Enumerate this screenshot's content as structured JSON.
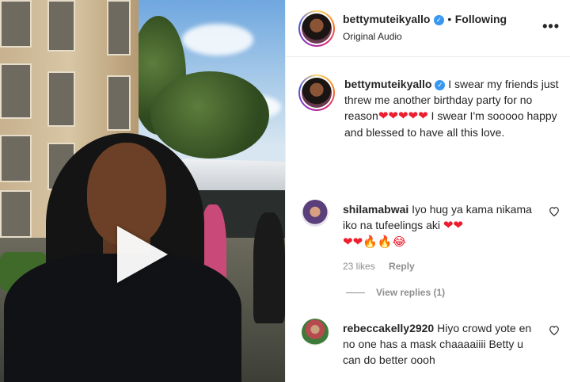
{
  "post": {
    "username": "bettymuteikyallo",
    "verified": true,
    "separator": "•",
    "follow_status": "Following",
    "audio": "Original Audio",
    "more_label": "•••"
  },
  "caption": {
    "username": "bettymuteikyallo",
    "text_1": "I swear my friends just threw me another birthday party for no reason",
    "hearts_1": "❤❤❤❤❤",
    "text_2": "I swear I'm sooooo happy and blessed to have all this love."
  },
  "comments": [
    {
      "username": "shilamabwai",
      "text": "Iyo hug ya kama nikama iko na tufeelings aki",
      "emoji_line_1": "❤❤",
      "emoji_line_2": "❤❤🔥🔥😂",
      "likes": "23 likes",
      "reply_label": "Reply",
      "view_replies": "View replies (1)"
    },
    {
      "username": "rebeccakelly2920",
      "text": "Hiyo crowd yote en no one has a mask chaaaaiiii Betty u can do better oooh"
    }
  ],
  "colors": {
    "verified": "#3897f0",
    "heart": "#ed1c2e",
    "meta_text": "#8e8e8e"
  },
  "icons": {
    "play": "play-icon",
    "like": "heart-outline-icon",
    "more": "more-options-icon"
  },
  "media": {
    "type": "video",
    "playing": false
  }
}
